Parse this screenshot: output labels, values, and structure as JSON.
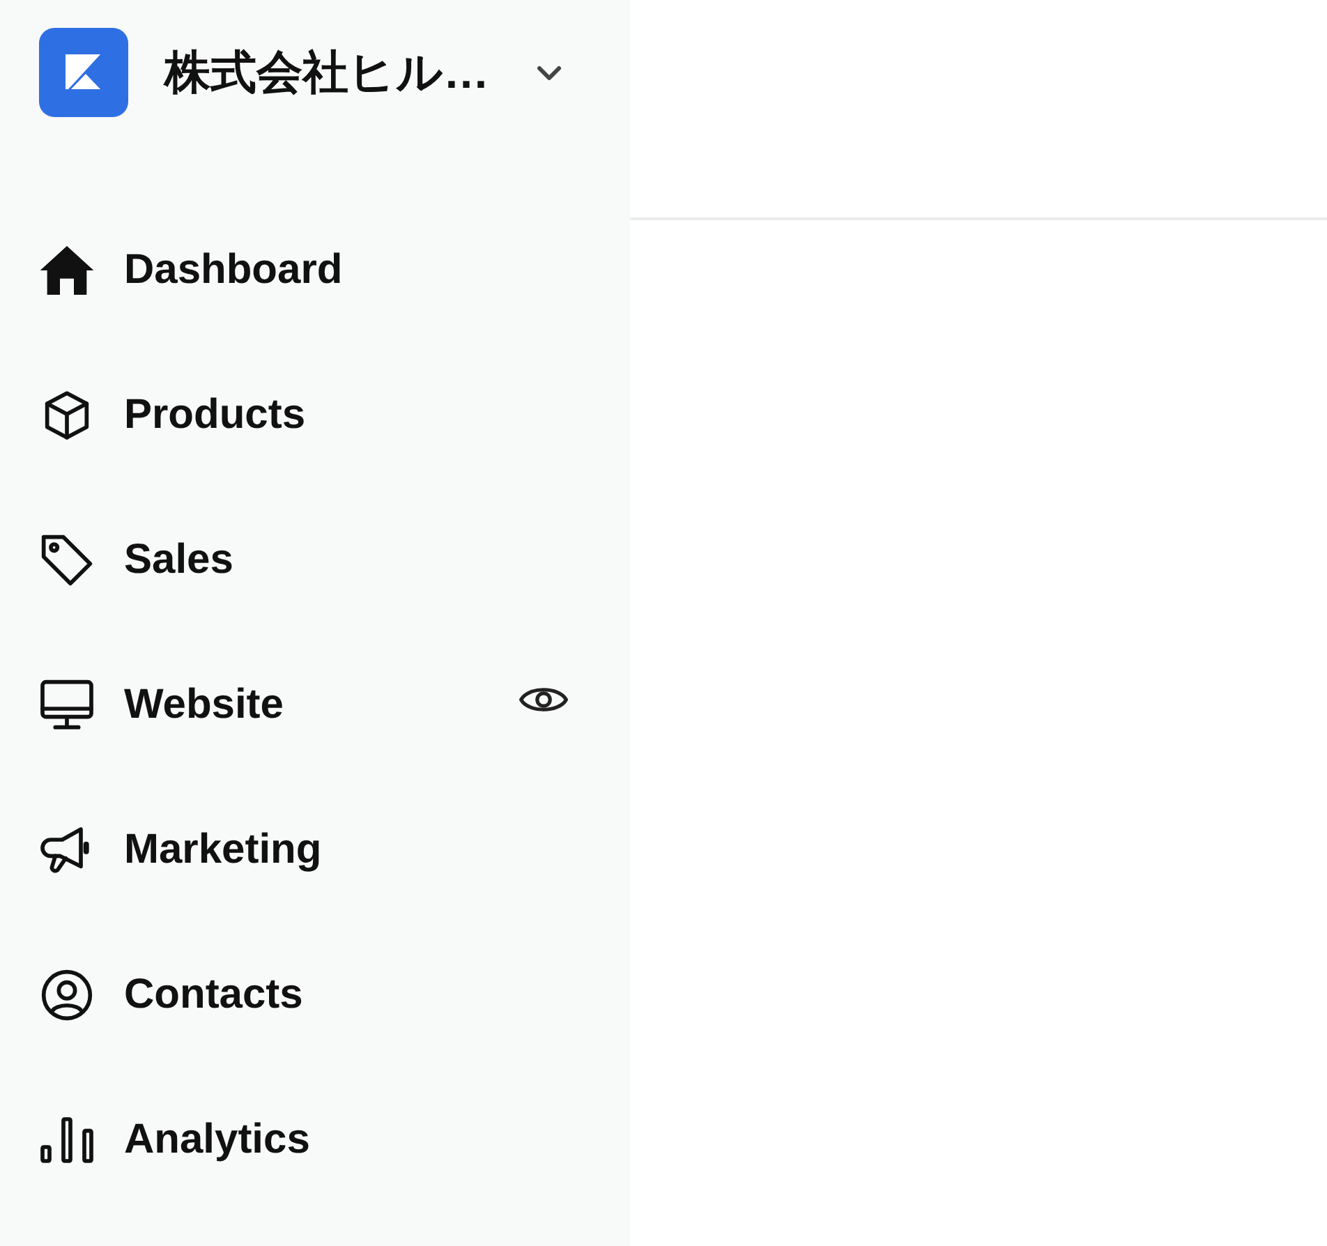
{
  "company": {
    "name": "株式会社ヒル…",
    "expanded": false
  },
  "nav": {
    "items": [
      {
        "label": "Dashboard",
        "preview": false
      },
      {
        "label": "Products",
        "preview": false
      },
      {
        "label": "Sales",
        "preview": false
      },
      {
        "label": "Website",
        "preview": true
      },
      {
        "label": "Marketing",
        "preview": false
      },
      {
        "label": "Contacts",
        "preview": false
      },
      {
        "label": "Analytics",
        "preview": false
      }
    ]
  }
}
